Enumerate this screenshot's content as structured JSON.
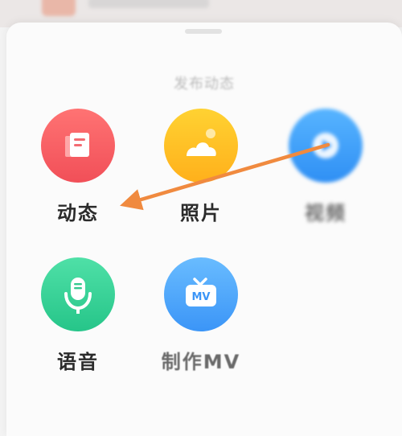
{
  "sheet": {
    "title": "发布动态"
  },
  "actions": [
    {
      "label": "动态",
      "icon": "note-icon",
      "color": "#f14f58"
    },
    {
      "label": "照片",
      "icon": "photo-icon",
      "color": "#ffb01b"
    },
    {
      "label": "视频",
      "icon": "video-icon",
      "color": "#2f8ff4"
    },
    {
      "label": "语音",
      "icon": "microphone-icon",
      "color": "#26c589"
    },
    {
      "label": "制作MV",
      "icon": "tv-mv-icon",
      "icon_text": "MV",
      "color": "#3b95f7"
    }
  ],
  "annotation": {
    "arrow_color": "#f08a3f"
  }
}
